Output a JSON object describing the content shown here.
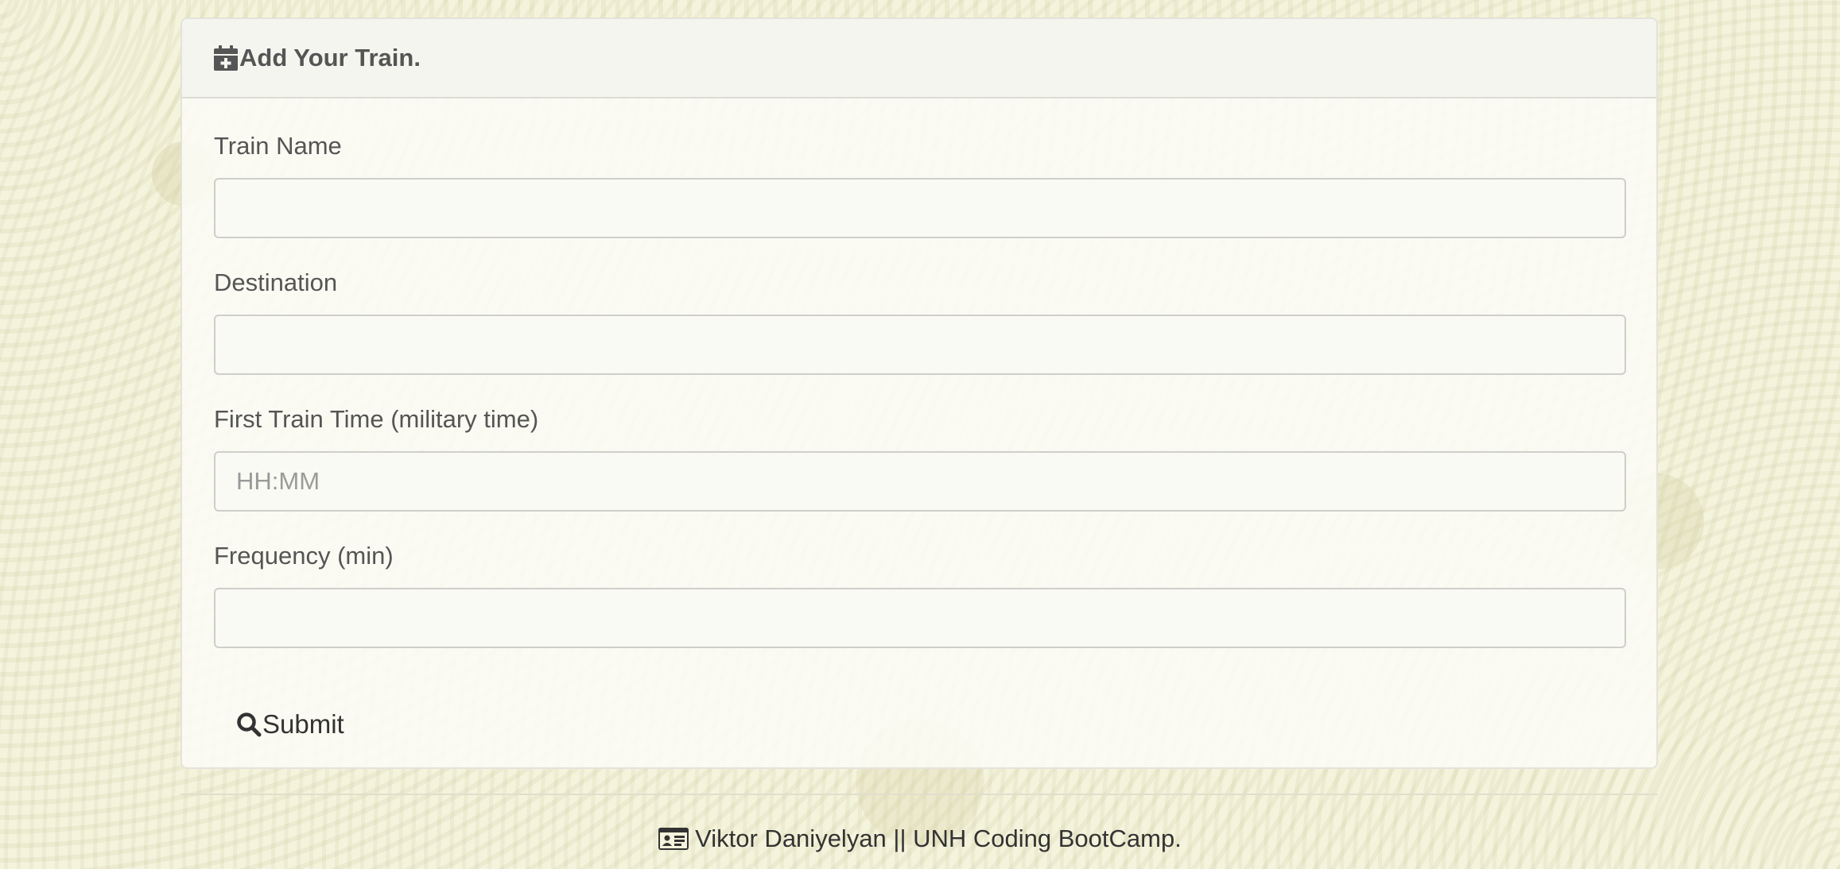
{
  "panel": {
    "title": "Add Your Train.",
    "title_icon": "calendar-plus-icon"
  },
  "form": {
    "fields": [
      {
        "label": "Train Name",
        "placeholder": "",
        "value": ""
      },
      {
        "label": "Destination",
        "placeholder": "",
        "value": ""
      },
      {
        "label": "First Train Time (military time)",
        "placeholder": "HH:MM",
        "value": ""
      },
      {
        "label": "Frequency (min)",
        "placeholder": "",
        "value": ""
      }
    ],
    "submit_label": "Submit",
    "submit_icon": "search-icon"
  },
  "footer": {
    "text": "Viktor Daniyelyan || UNH Coding BootCamp.",
    "icon": "id-card-icon"
  },
  "colors": {
    "background": "#f4f3dc",
    "text": "#555555",
    "border": "#cfcfca"
  }
}
